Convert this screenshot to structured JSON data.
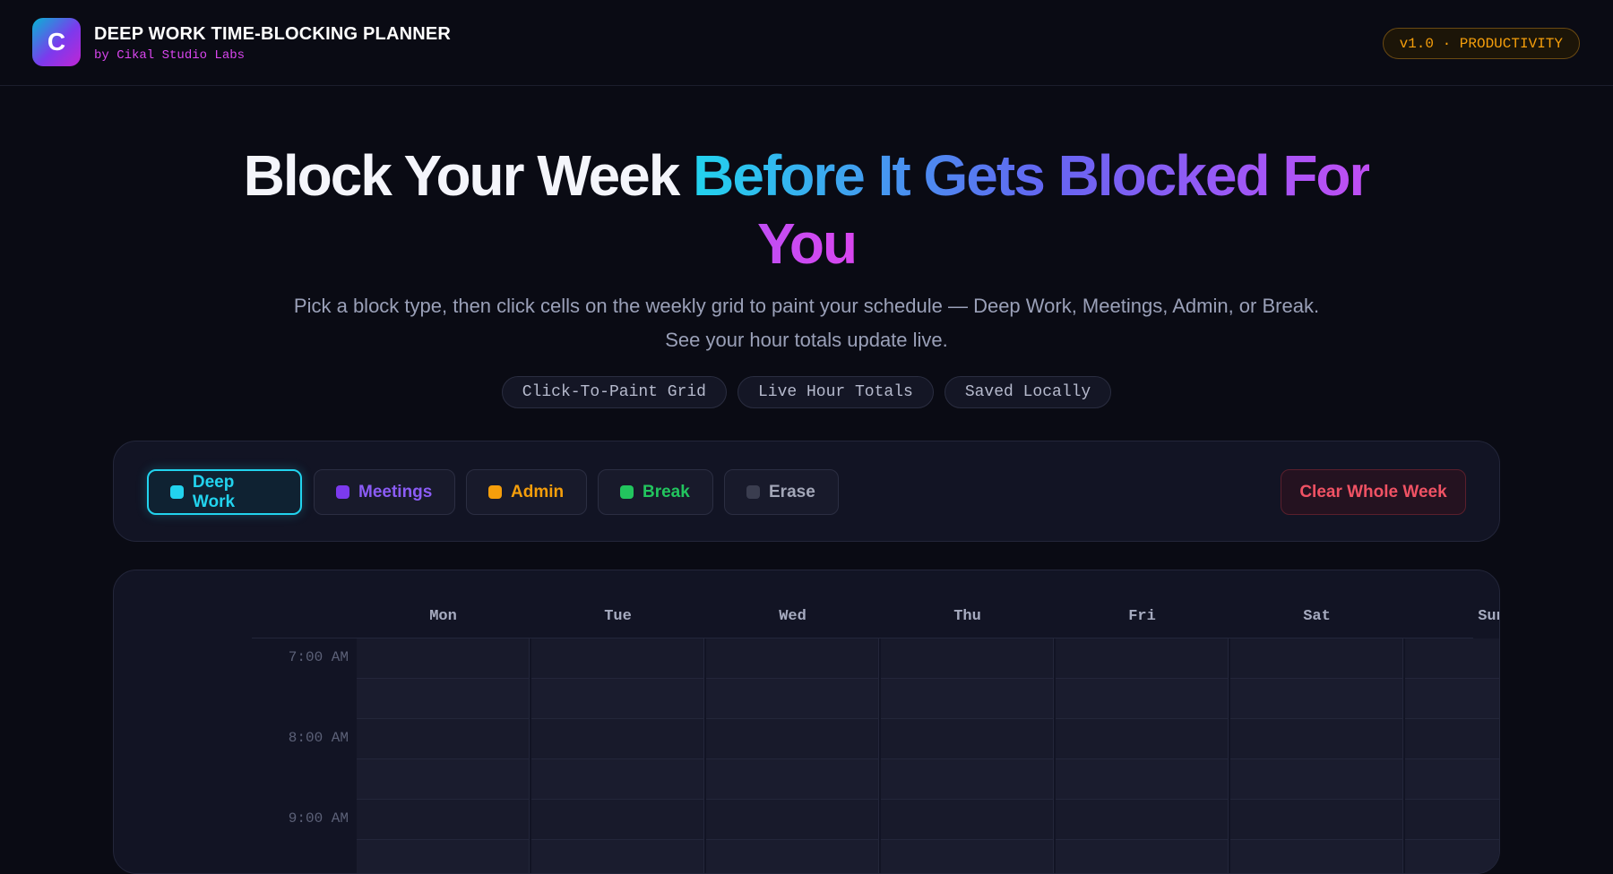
{
  "header": {
    "logo_letter": "C",
    "title": "DEEP WORK TIME-BLOCKING PLANNER",
    "subtitle": "by Cikal Studio Labs",
    "version_badge": "v1.0 · PRODUCTIVITY"
  },
  "hero": {
    "title_plain": "Block Your Week ",
    "title_gradient": "Before It Gets Blocked For You",
    "description": "Pick a block type, then click cells on the weekly grid to paint your schedule — Deep Work, Meetings, Admin, or Break. See your hour totals update live.",
    "chips": [
      "Click-To-Paint Grid",
      "Live Hour Totals",
      "Saved Locally"
    ]
  },
  "toolbar": {
    "tools": [
      {
        "label": "Deep Work",
        "color": "#22d3ee",
        "active": true
      },
      {
        "label": "Meetings",
        "color": "#7c3aed",
        "active": false
      },
      {
        "label": "Admin",
        "color": "#f59e0b",
        "active": false
      },
      {
        "label": "Break",
        "color": "#22c55e",
        "active": false
      },
      {
        "label": "Erase",
        "color": "#3a3d4f",
        "active": false
      }
    ],
    "clear_label": "Clear Whole Week"
  },
  "grid": {
    "days": [
      "Mon",
      "Tue",
      "Wed",
      "Thu",
      "Fri",
      "Sat",
      "Sun"
    ],
    "times": [
      "7:00 AM",
      "8:00 AM",
      "9:00 AM"
    ]
  },
  "colors": {
    "background": "#0a0b14",
    "card": "#121424",
    "accent_cyan": "#22d3ee",
    "accent_magenta": "#d946ef",
    "danger": "#f05264"
  }
}
